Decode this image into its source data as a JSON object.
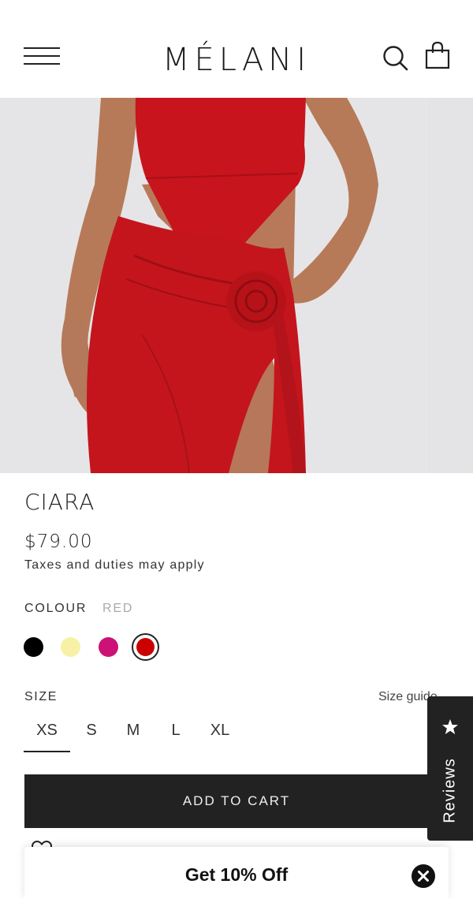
{
  "header": {
    "brand": "MÉLANI",
    "menu_icon": "hamburger-menu-icon",
    "search_icon": "search-icon",
    "cart_icon": "shopping-bag-icon"
  },
  "gallery": {
    "image_description_icon": "product-photo",
    "accent_color": "#c4151c"
  },
  "product": {
    "name": "CIARA",
    "price": "$79.00",
    "taxes_note": "Taxes and duties may apply"
  },
  "colour": {
    "label": "COLOUR",
    "selected": "RED",
    "options": [
      {
        "name": "black",
        "hex": "#000000"
      },
      {
        "name": "lemon",
        "hex": "#f7f1a6"
      },
      {
        "name": "magenta",
        "hex": "#cc1276"
      },
      {
        "name": "red",
        "hex": "#cc0000",
        "selected": true
      }
    ]
  },
  "size": {
    "label": "SIZE",
    "guide_label": "Size guide",
    "options": [
      "XS",
      "S",
      "M",
      "L",
      "XL"
    ],
    "selected": "XS"
  },
  "actions": {
    "add_to_cart": "ADD TO CART",
    "wishlist_icon": "heart-icon"
  },
  "reviews_tab": {
    "label": "Reviews",
    "icon": "star-icon"
  },
  "promo": {
    "text": "Get 10% Off",
    "close_icon": "close-icon"
  }
}
